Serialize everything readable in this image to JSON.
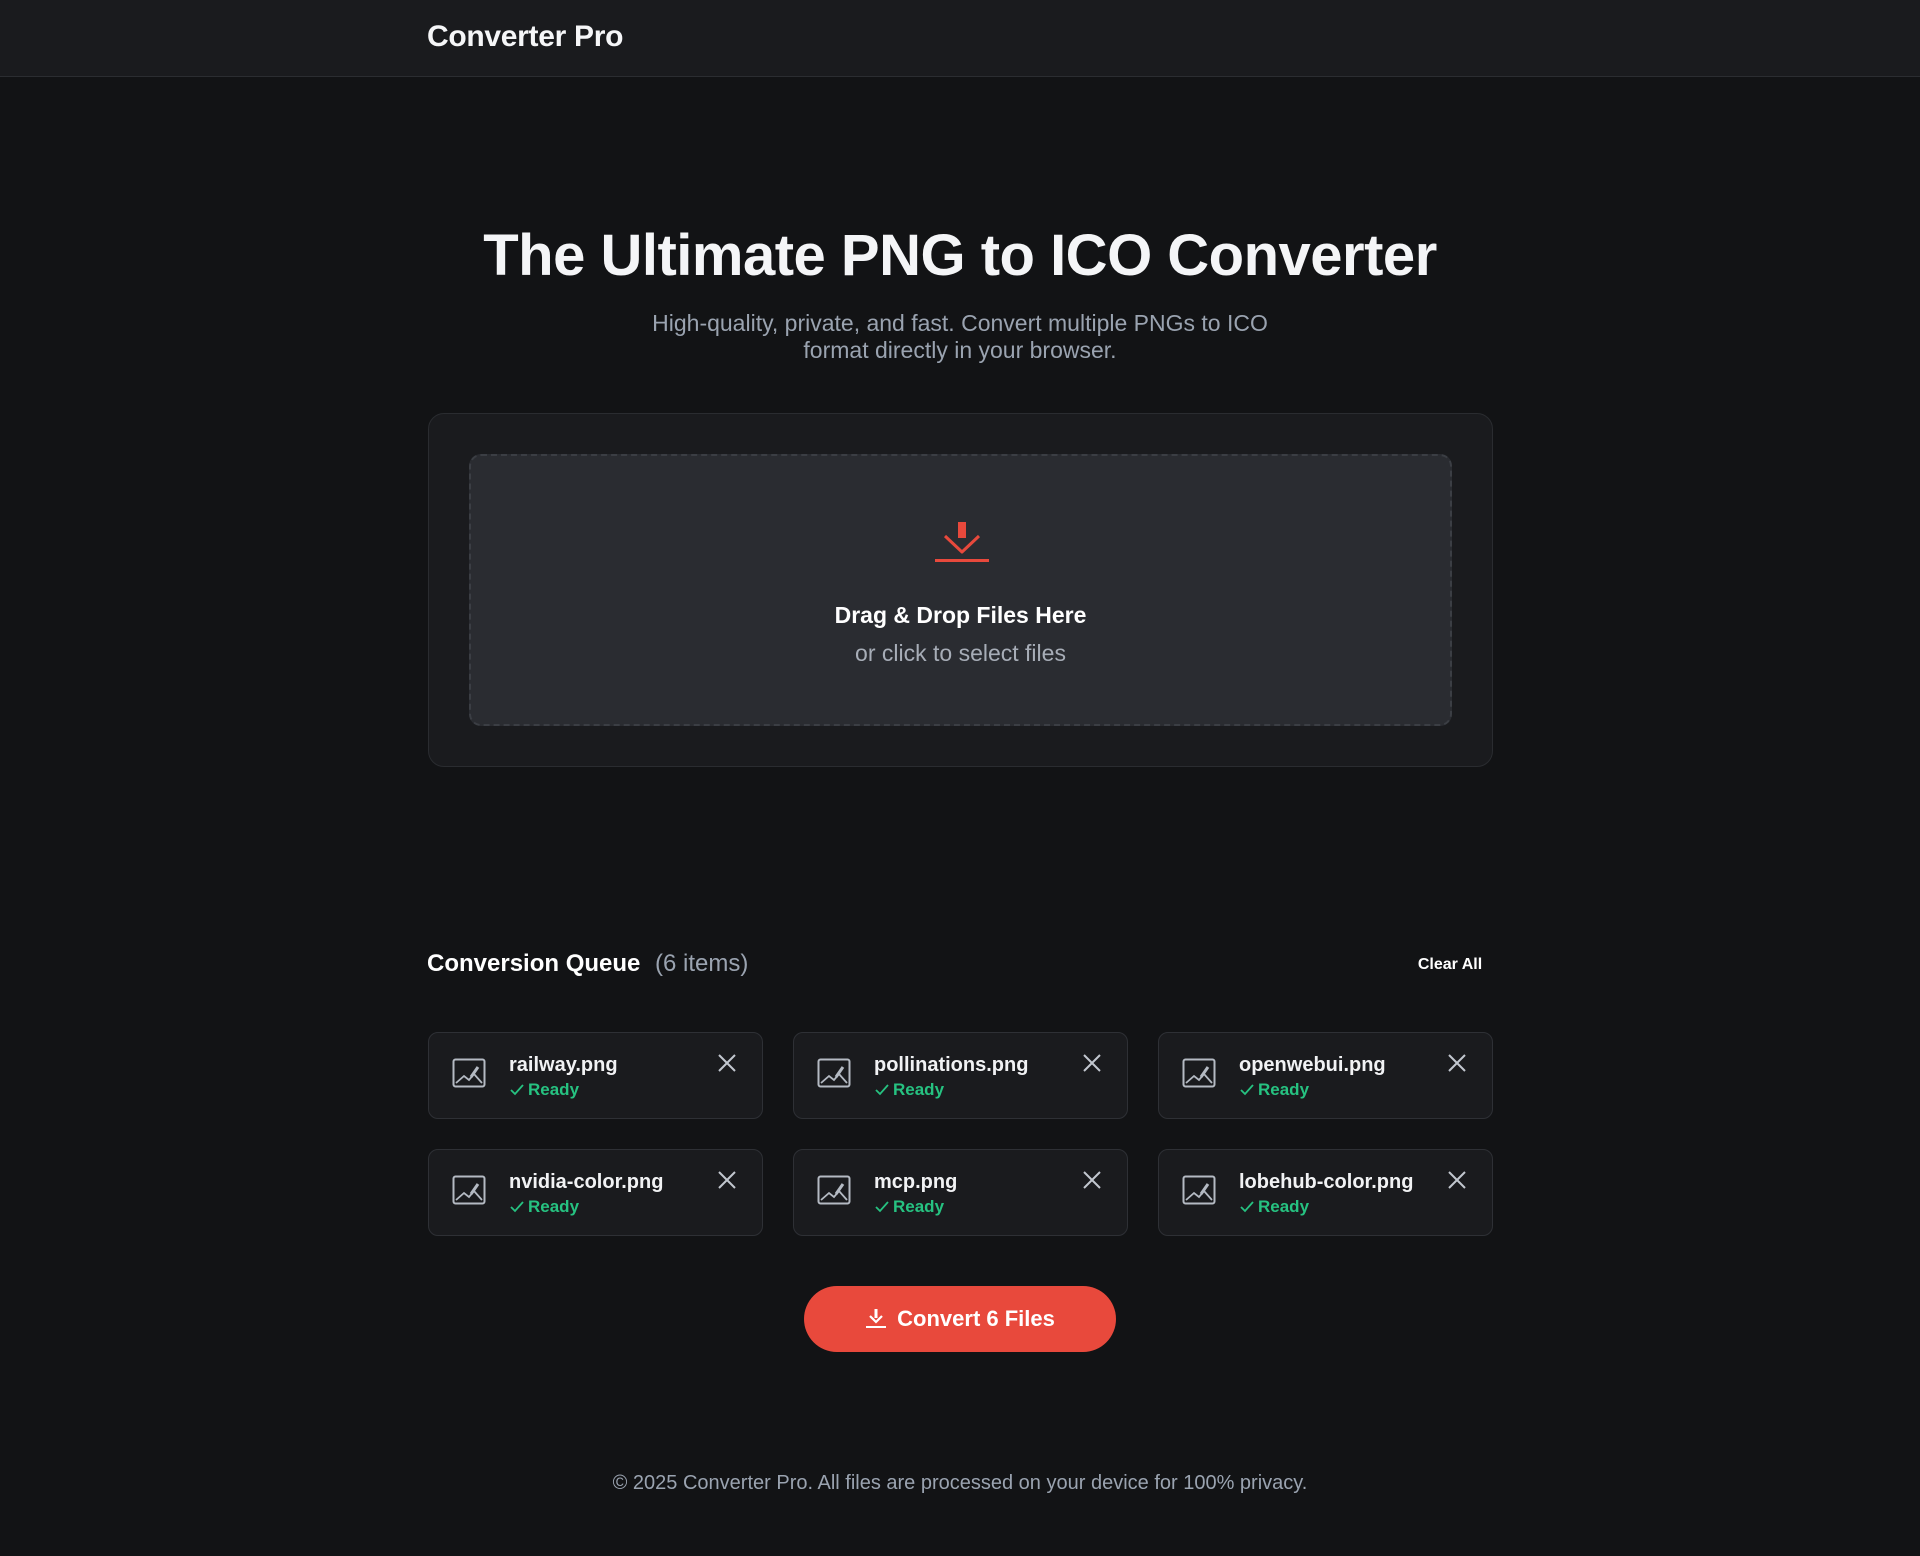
{
  "header": {
    "brand": "Converter Pro"
  },
  "hero": {
    "title": "The Ultimate PNG to ICO Converter",
    "subtitle": "High-quality, private, and fast. Convert multiple PNGs to ICO format directly in your browser."
  },
  "upload": {
    "icon": "download-icon",
    "title": "Drag & Drop Files Here",
    "hint": "or click to select files"
  },
  "queue": {
    "title": "Conversion Queue",
    "count": "(6 items)",
    "clear_label": "Clear All",
    "files": [
      {
        "name": "railway.png",
        "status": "Ready"
      },
      {
        "name": "pollinations.png",
        "status": "Ready"
      },
      {
        "name": "openwebui.png",
        "status": "Ready"
      },
      {
        "name": "nvidia-color.png",
        "status": "Ready"
      },
      {
        "name": "mcp.png",
        "status": "Ready"
      },
      {
        "name": "lobehub-color.png",
        "status": "Ready"
      }
    ]
  },
  "convert": {
    "label": "Convert 6 Files",
    "icon": "download-icon"
  },
  "footer": {
    "text": "© 2025 Converter Pro. All files are processed on your device for 100% privacy."
  },
  "colors": {
    "background": "#121315",
    "accent": "#e8493c",
    "status_ready": "#26c281",
    "card": "#1a1b1e"
  }
}
